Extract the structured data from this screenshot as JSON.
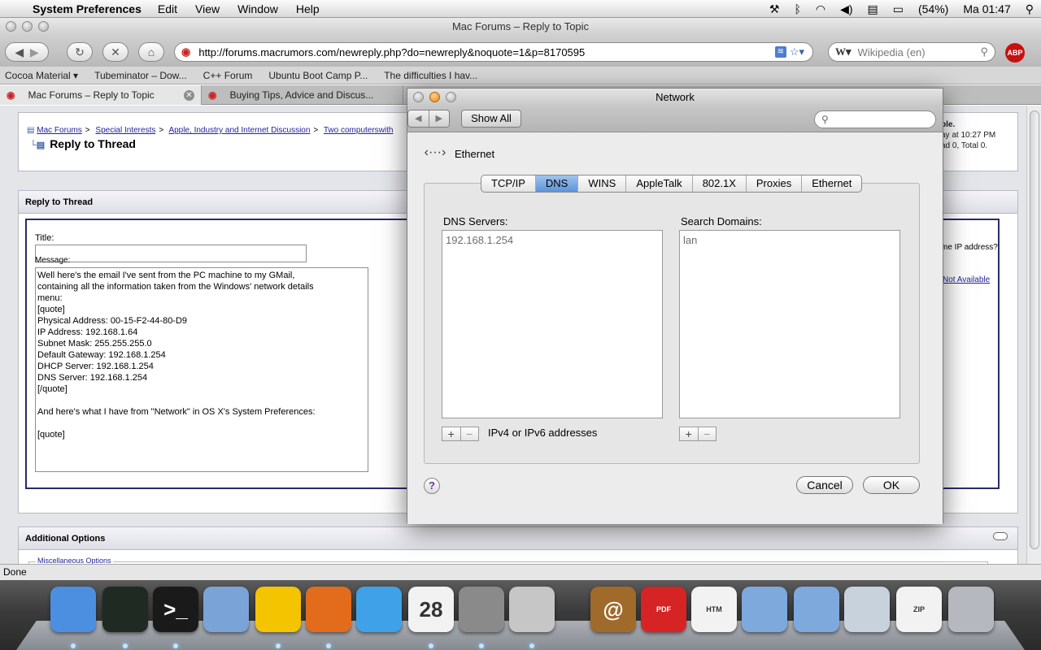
{
  "menubar": {
    "app_name": "System Preferences",
    "menus": [
      "Edit",
      "View",
      "Window",
      "Help"
    ],
    "battery": "(54%)",
    "clock": "Ma 01:47"
  },
  "browser": {
    "window_title": "Mac Forums – Reply to Topic",
    "url": "http://forums.macrumors.com/newreply.php?do=newreply&noquote=1&p=8170595",
    "search_engine": "Wikipedia (en)",
    "bookmarks": [
      "Cocoa Material ▾",
      "Tubeminator – Dow...",
      "C++ Forum",
      "Ubuntu Boot Camp P...",
      "The difficulties I hav..."
    ],
    "tabs": [
      {
        "label": "Mac Forums – Reply to Topic"
      },
      {
        "label": "Buying Tips, Advice and Discus..."
      }
    ],
    "status": "Done"
  },
  "forum": {
    "breadcrumb": [
      "Mac Forums",
      "Special Interests",
      "Apple, Industry and Internet Discussion",
      "Two computerswith"
    ],
    "page_heading": "Reply to Thread",
    "right_info": [
      "ple.",
      "ay at 10:27 PM",
      "ad 0, Total 0."
    ],
    "reply_panel_title": "Reply to Thread",
    "title_label": "Title:",
    "message_label": "Message:",
    "message_text": "Well here's the email I've sent from the PC machine to my GMail,\ncontaining all the information taken from the Windows' network details\nmenu:\n[quote]\nPhysical Address: 00-15-F2-44-80-D9\nIP Address: 192.168.1.64\nSubnet Mask: 255.255.255.0\nDefault Gateway: 192.168.1.254\nDHCP Server: 192.168.1.254\nDNS Server: 192.168.1.254\n[/quote]\n\nAnd here's what I have from \"Network\" in OS X's System Preferences:\n\n[quote]",
    "side_question": "me IP address?",
    "side_link": "Not Available",
    "additional_options": "Additional Options",
    "misc_options": "Miscellaneous Options"
  },
  "network": {
    "window_title": "Network",
    "show_all": "Show All",
    "interface": "Ethernet",
    "tabs": [
      "TCP/IP",
      "DNS",
      "WINS",
      "AppleTalk",
      "802.1X",
      "Proxies",
      "Ethernet"
    ],
    "selected_tab": "DNS",
    "dns_servers_label": "DNS Servers:",
    "dns_servers": [
      "192.168.1.254"
    ],
    "search_domains_label": "Search Domains:",
    "search_domains": [
      "lan"
    ],
    "address_hint": "IPv4 or IPv6 addresses",
    "help": "?",
    "cancel": "Cancel",
    "ok": "OK"
  },
  "dock": {
    "items": [
      {
        "icon": "finder-icon",
        "label": "",
        "color": "#4c8fe0"
      },
      {
        "icon": "activity-monitor-icon",
        "label": "",
        "color": "#1f2a22"
      },
      {
        "icon": "terminal-icon",
        "label": ">_",
        "color": "#1a1a1a"
      },
      {
        "icon": "mail-icon",
        "label": "",
        "color": "#7aa3d8"
      },
      {
        "icon": "adium-icon",
        "label": "",
        "color": "#f5c400"
      },
      {
        "icon": "firefox-icon",
        "label": "",
        "color": "#e36b1c"
      },
      {
        "icon": "itunes-icon",
        "label": "",
        "color": "#3fa2e8"
      },
      {
        "icon": "ical-icon",
        "label": "28",
        "color": "#f2f2f2"
      },
      {
        "icon": "system-preferences-icon",
        "label": "",
        "color": "#8a8a8a"
      },
      {
        "icon": "preview-icon",
        "label": "",
        "color": "#c6c6c6"
      },
      {
        "icon": "address-book-icon",
        "label": "@",
        "color": "#a06a2a"
      },
      {
        "icon": "pdf-document-icon",
        "label": "PDF",
        "color": "#d62424"
      },
      {
        "icon": "html-document-icon",
        "label": "HTM",
        "color": "#f2f2f2"
      },
      {
        "icon": "folder-icon",
        "label": "",
        "color": "#7ea9dc"
      },
      {
        "icon": "downloads-folder-icon",
        "label": "",
        "color": "#7ea9dc"
      },
      {
        "icon": "photo-stack-icon",
        "label": "",
        "color": "#c8d2dd"
      },
      {
        "icon": "zip-archive-icon",
        "label": "ZIP",
        "color": "#f2f2f2"
      },
      {
        "icon": "trash-icon",
        "label": "",
        "color": "#b5b9bf"
      }
    ]
  }
}
